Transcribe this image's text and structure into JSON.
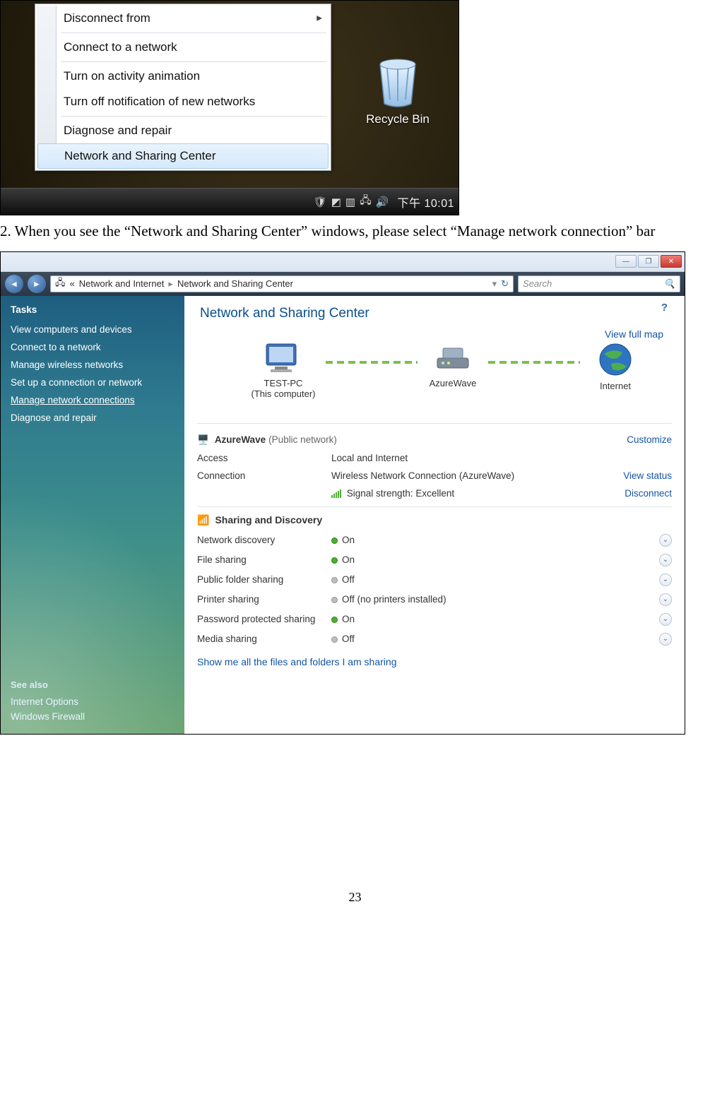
{
  "shot1": {
    "context_menu": {
      "items": [
        {
          "label": "Disconnect from",
          "has_sub": true
        },
        {
          "label": "Connect to a network"
        },
        {
          "label": "Turn on activity animation"
        },
        {
          "label": "Turn off notification of new networks"
        },
        {
          "label": "Diagnose and repair"
        },
        {
          "label": "Network and Sharing Center",
          "highlight": true
        }
      ]
    },
    "desktop": {
      "recycle_bin": "Recycle Bin"
    },
    "tray": {
      "clock": "下午 10:01"
    }
  },
  "instruction": "2. When you see the “Network and Sharing Center” windows, please select “Manage network connection” bar",
  "shot2": {
    "address_bar": {
      "segments": [
        "Network and Internet",
        "Network and Sharing Center"
      ],
      "prefix": "«"
    },
    "search_placeholder": "Search",
    "sidebar": {
      "heading": "Tasks",
      "items": [
        "View computers and devices",
        "Connect to a network",
        "Manage wireless networks",
        "Set up a connection or network",
        "Manage network connections",
        "Diagnose and repair"
      ],
      "highlight_index": 4,
      "see_also": {
        "heading": "See also",
        "items": [
          "Internet Options",
          "Windows Firewall"
        ]
      }
    },
    "main": {
      "title": "Network and Sharing Center",
      "view_full_map": "View full map",
      "nodes": {
        "pc": {
          "label": "TEST-PC",
          "sub": "(This computer)"
        },
        "router": {
          "label": "AzureWave"
        },
        "internet": {
          "label": "Internet"
        }
      },
      "network": {
        "name": "AzureWave",
        "type": "(Public network)",
        "customize": "Customize",
        "rows": [
          {
            "label": "Access",
            "value": "Local and Internet"
          },
          {
            "label": "Connection",
            "value": "Wireless Network Connection (AzureWave)",
            "right": "View status"
          },
          {
            "label": "",
            "value": "Signal strength:  Excellent",
            "signal": true,
            "right": "Disconnect"
          }
        ]
      },
      "sharing": {
        "heading": "Sharing and Discovery",
        "rows": [
          {
            "label": "Network discovery",
            "state": "On",
            "on": true
          },
          {
            "label": "File sharing",
            "state": "On",
            "on": true
          },
          {
            "label": "Public folder sharing",
            "state": "Off",
            "on": false
          },
          {
            "label": "Printer sharing",
            "state": "Off (no printers installed)",
            "on": false
          },
          {
            "label": "Password protected sharing",
            "state": "On",
            "on": true
          },
          {
            "label": "Media sharing",
            "state": "Off",
            "on": false
          }
        ],
        "footer_link": "Show me all the files and folders I am sharing"
      }
    }
  },
  "page_number": "23"
}
